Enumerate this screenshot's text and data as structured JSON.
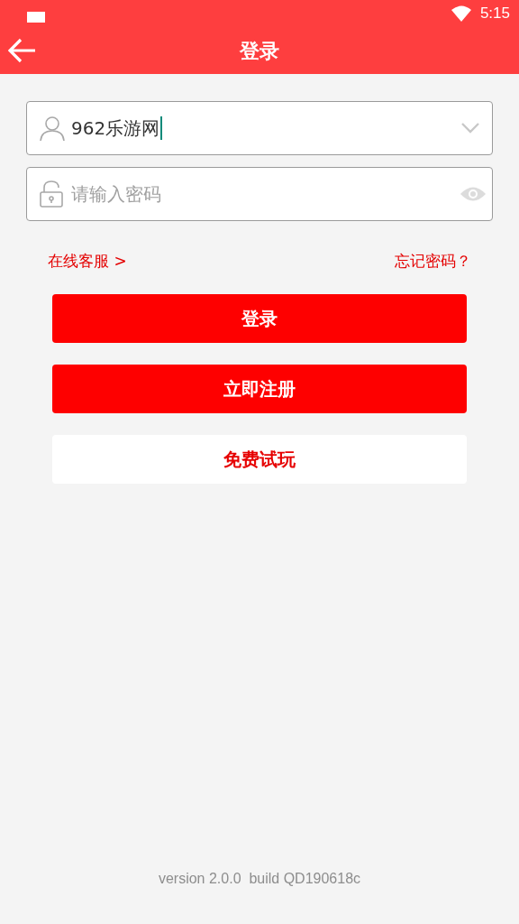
{
  "status_bar": {
    "time": "5:15"
  },
  "header": {
    "title": "登录"
  },
  "username_field": {
    "value": "962乐游网"
  },
  "password_field": {
    "placeholder": "请输入密码"
  },
  "links": {
    "support": "在线客服 >",
    "forgot": "忘记密码？"
  },
  "buttons": [
    {
      "label": "登录",
      "kind": "primary"
    },
    {
      "label": "立即注册",
      "kind": "primary"
    },
    {
      "label": "免费试玩",
      "kind": "secondary"
    }
  ],
  "footer": {
    "version": "version 2.0.0  build QD190618c"
  }
}
